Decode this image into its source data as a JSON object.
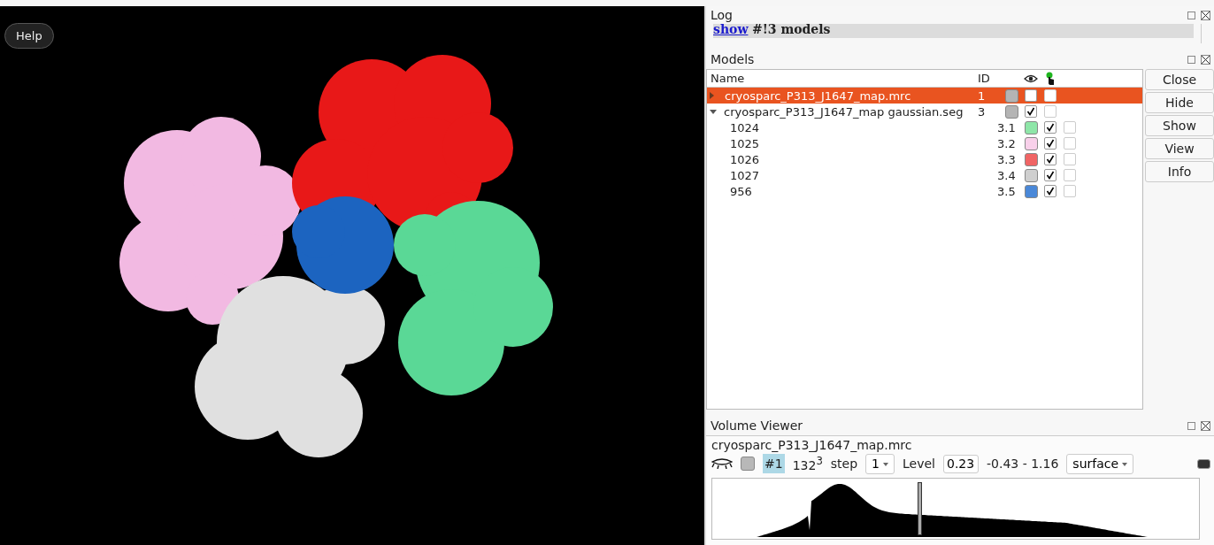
{
  "help_button": "Help",
  "log": {
    "title": "Log",
    "link": "show",
    "text": "#!3 models"
  },
  "models": {
    "title": "Models",
    "columns": [
      "Name",
      "ID"
    ],
    "rows": [
      {
        "name": "cryosparc_P313_J1647_map.mrc",
        "id": "1",
        "color": "#b4b4b4",
        "shown": false,
        "selected": true,
        "expanded": false
      },
      {
        "name": "cryosparc_P313_J1647_map gaussian.seg",
        "id": "3",
        "color": "#b4b4b4",
        "shown": true,
        "selected": false,
        "expanded": true,
        "children": [
          {
            "name": "1024",
            "id": "3.1",
            "color": "#8ee6a8",
            "shown": true,
            "selected": false
          },
          {
            "name": "1025",
            "id": "3.2",
            "color": "#f8d0ea",
            "shown": true,
            "selected": false
          },
          {
            "name": "1026",
            "id": "3.3",
            "color": "#f06464",
            "shown": true,
            "selected": false
          },
          {
            "name": "1027",
            "id": "3.4",
            "color": "#cfcfcf",
            "shown": true,
            "selected": false
          },
          {
            "name": "956",
            "id": "3.5",
            "color": "#4a88d8",
            "shown": true,
            "selected": false
          }
        ]
      }
    ],
    "buttons": [
      "Close",
      "Hide",
      "Show",
      "View",
      "Info"
    ]
  },
  "volume_viewer": {
    "title": "Volume Viewer",
    "map_name": "cryosparc_P313_J1647_map.mrc",
    "model_id": "#1",
    "size": "132$^{3}$",
    "step_label": "step",
    "step": "1",
    "level_label": "Level",
    "level_value": "0.23",
    "range": "-0.43 - 1.16",
    "style": "surface"
  }
}
